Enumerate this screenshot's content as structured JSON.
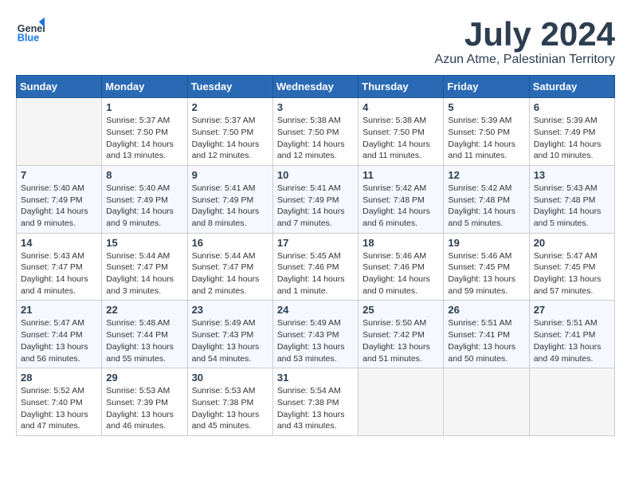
{
  "logo": {
    "text_general": "General",
    "text_blue": "Blue"
  },
  "header": {
    "month": "July 2024",
    "location": "Azun Atme, Palestinian Territory"
  },
  "weekdays": [
    "Sunday",
    "Monday",
    "Tuesday",
    "Wednesday",
    "Thursday",
    "Friday",
    "Saturday"
  ],
  "weeks": [
    [
      {
        "day": "",
        "empty": true
      },
      {
        "day": "1",
        "sunrise": "5:37 AM",
        "sunset": "7:50 PM",
        "daylight": "14 hours and 13 minutes."
      },
      {
        "day": "2",
        "sunrise": "5:37 AM",
        "sunset": "7:50 PM",
        "daylight": "14 hours and 12 minutes."
      },
      {
        "day": "3",
        "sunrise": "5:38 AM",
        "sunset": "7:50 PM",
        "daylight": "14 hours and 12 minutes."
      },
      {
        "day": "4",
        "sunrise": "5:38 AM",
        "sunset": "7:50 PM",
        "daylight": "14 hours and 11 minutes."
      },
      {
        "day": "5",
        "sunrise": "5:39 AM",
        "sunset": "7:50 PM",
        "daylight": "14 hours and 11 minutes."
      },
      {
        "day": "6",
        "sunrise": "5:39 AM",
        "sunset": "7:49 PM",
        "daylight": "14 hours and 10 minutes."
      }
    ],
    [
      {
        "day": "7",
        "sunrise": "5:40 AM",
        "sunset": "7:49 PM",
        "daylight": "14 hours and 9 minutes."
      },
      {
        "day": "8",
        "sunrise": "5:40 AM",
        "sunset": "7:49 PM",
        "daylight": "14 hours and 9 minutes."
      },
      {
        "day": "9",
        "sunrise": "5:41 AM",
        "sunset": "7:49 PM",
        "daylight": "14 hours and 8 minutes."
      },
      {
        "day": "10",
        "sunrise": "5:41 AM",
        "sunset": "7:49 PM",
        "daylight": "14 hours and 7 minutes."
      },
      {
        "day": "11",
        "sunrise": "5:42 AM",
        "sunset": "7:48 PM",
        "daylight": "14 hours and 6 minutes."
      },
      {
        "day": "12",
        "sunrise": "5:42 AM",
        "sunset": "7:48 PM",
        "daylight": "14 hours and 5 minutes."
      },
      {
        "day": "13",
        "sunrise": "5:43 AM",
        "sunset": "7:48 PM",
        "daylight": "14 hours and 5 minutes."
      }
    ],
    [
      {
        "day": "14",
        "sunrise": "5:43 AM",
        "sunset": "7:47 PM",
        "daylight": "14 hours and 4 minutes."
      },
      {
        "day": "15",
        "sunrise": "5:44 AM",
        "sunset": "7:47 PM",
        "daylight": "14 hours and 3 minutes."
      },
      {
        "day": "16",
        "sunrise": "5:44 AM",
        "sunset": "7:47 PM",
        "daylight": "14 hours and 2 minutes."
      },
      {
        "day": "17",
        "sunrise": "5:45 AM",
        "sunset": "7:46 PM",
        "daylight": "14 hours and 1 minute."
      },
      {
        "day": "18",
        "sunrise": "5:46 AM",
        "sunset": "7:46 PM",
        "daylight": "14 hours and 0 minutes."
      },
      {
        "day": "19",
        "sunrise": "5:46 AM",
        "sunset": "7:45 PM",
        "daylight": "13 hours and 59 minutes."
      },
      {
        "day": "20",
        "sunrise": "5:47 AM",
        "sunset": "7:45 PM",
        "daylight": "13 hours and 57 minutes."
      }
    ],
    [
      {
        "day": "21",
        "sunrise": "5:47 AM",
        "sunset": "7:44 PM",
        "daylight": "13 hours and 56 minutes."
      },
      {
        "day": "22",
        "sunrise": "5:48 AM",
        "sunset": "7:44 PM",
        "daylight": "13 hours and 55 minutes."
      },
      {
        "day": "23",
        "sunrise": "5:49 AM",
        "sunset": "7:43 PM",
        "daylight": "13 hours and 54 minutes."
      },
      {
        "day": "24",
        "sunrise": "5:49 AM",
        "sunset": "7:43 PM",
        "daylight": "13 hours and 53 minutes."
      },
      {
        "day": "25",
        "sunrise": "5:50 AM",
        "sunset": "7:42 PM",
        "daylight": "13 hours and 51 minutes."
      },
      {
        "day": "26",
        "sunrise": "5:51 AM",
        "sunset": "7:41 PM",
        "daylight": "13 hours and 50 minutes."
      },
      {
        "day": "27",
        "sunrise": "5:51 AM",
        "sunset": "7:41 PM",
        "daylight": "13 hours and 49 minutes."
      }
    ],
    [
      {
        "day": "28",
        "sunrise": "5:52 AM",
        "sunset": "7:40 PM",
        "daylight": "13 hours and 47 minutes."
      },
      {
        "day": "29",
        "sunrise": "5:53 AM",
        "sunset": "7:39 PM",
        "daylight": "13 hours and 46 minutes."
      },
      {
        "day": "30",
        "sunrise": "5:53 AM",
        "sunset": "7:38 PM",
        "daylight": "13 hours and 45 minutes."
      },
      {
        "day": "31",
        "sunrise": "5:54 AM",
        "sunset": "7:38 PM",
        "daylight": "13 hours and 43 minutes."
      },
      {
        "day": "",
        "empty": true
      },
      {
        "day": "",
        "empty": true
      },
      {
        "day": "",
        "empty": true
      }
    ]
  ],
  "labels": {
    "sunrise": "Sunrise:",
    "sunset": "Sunset:",
    "daylight": "Daylight hours"
  }
}
